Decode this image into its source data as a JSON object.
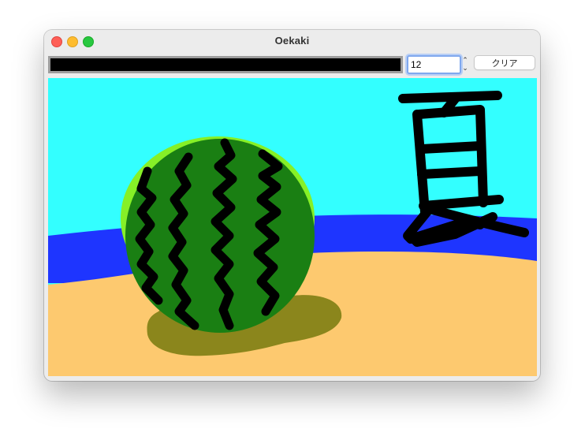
{
  "window": {
    "title": "Oekaki"
  },
  "toolbar": {
    "pen_color": "#000000",
    "pen_size": "12",
    "clear_label": "クリア"
  },
  "canvas": {
    "text_kanji": "夏",
    "colors": {
      "sky": "#33ffff",
      "sea": "#1e35ff",
      "sand": "#fdc96f",
      "shadow": "#8b861c",
      "melon_light": "#86f027",
      "melon_dark": "#1a7f13",
      "stripes": "#000000"
    }
  }
}
